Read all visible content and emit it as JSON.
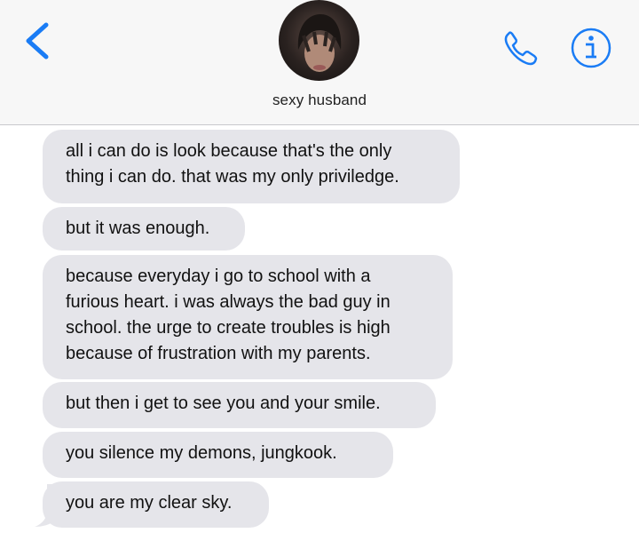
{
  "header": {
    "contact_name": "sexy husband",
    "back_icon": "chevron-left-icon",
    "call_icon": "phone-icon",
    "info_icon": "info-icon",
    "accent_color": "#1a7cf5"
  },
  "messages": [
    {
      "text": "all i can do is look because that's the only\nthing i can do. that was my only priviledge."
    },
    {
      "text": "but it was enough."
    },
    {
      "text": "because everyday i go to school with a\nfurious heart. i was always the bad guy in\nschool. the urge to create troubles is high\nbecause of frustration with my parents."
    },
    {
      "text": "but then i get to see you and your smile."
    },
    {
      "text": "you silence my demons, jungkook."
    },
    {
      "text": "you are my clear sky."
    }
  ],
  "colors": {
    "bubble": "#e5e5ea",
    "header_bg": "#f7f7f7"
  }
}
